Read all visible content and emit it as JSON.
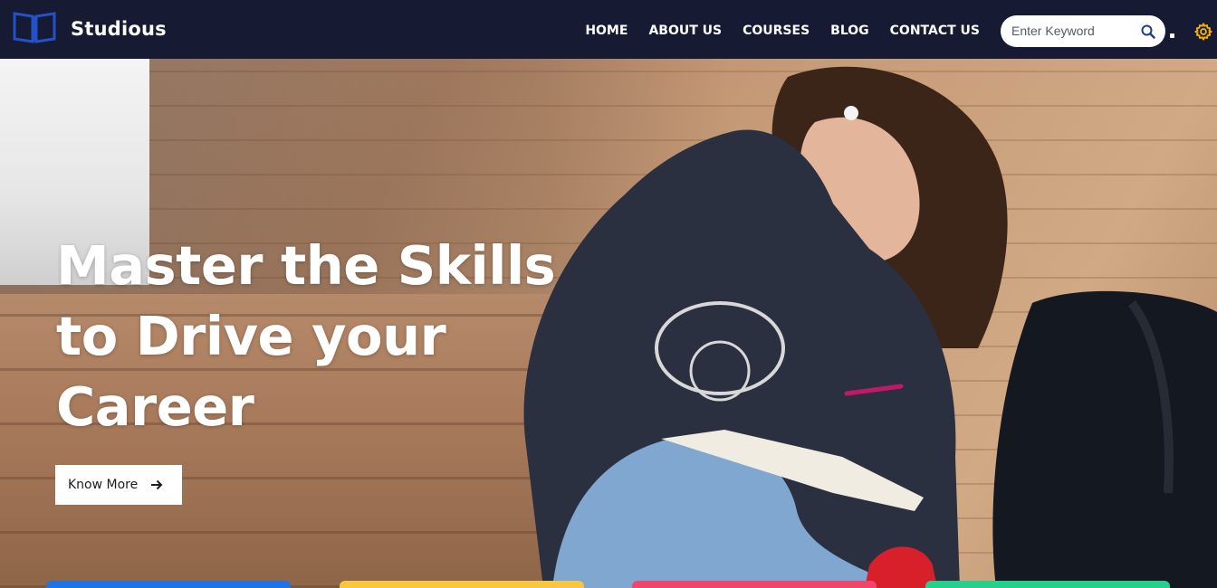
{
  "brand": {
    "name": "Studious",
    "logo_icon": "open-book-icon",
    "logo_color": "#2451c8"
  },
  "nav": {
    "links": [
      "HOME",
      "ABOUT US",
      "COURSES",
      "BLOG",
      "CONTACT US"
    ]
  },
  "search": {
    "placeholder": "Enter Keyword",
    "icon": "search-icon",
    "icon_color": "#1f3a8a"
  },
  "settings": {
    "icon": "gear-icon",
    "color": "#f5b400"
  },
  "hero": {
    "title_lines": [
      "Master the Skills",
      "to Drive your",
      "Career"
    ],
    "cta_label": "Know More",
    "cta_icon": "arrow-right-icon"
  },
  "feature_cards": {
    "colors": [
      "#1e73e8",
      "#f7c740",
      "#f2456d",
      "#23d18b"
    ]
  },
  "colors": {
    "navbar_bg": "#161b33",
    "text_light": "#ffffff"
  }
}
